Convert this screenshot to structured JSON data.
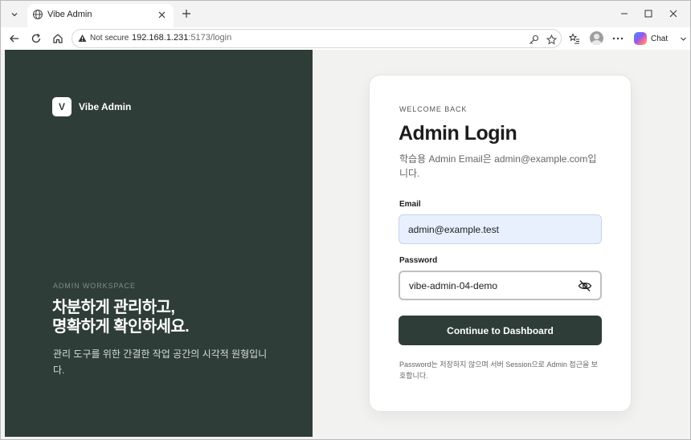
{
  "browser": {
    "tab_title": "Vibe Admin",
    "security_label": "Not secure",
    "url_host": "192.168.1.231",
    "url_path": ":5173/login",
    "chat_label": "Chat"
  },
  "left_panel": {
    "brand_mark": "V",
    "brand_name": "Vibe Admin",
    "eyebrow": "ADMIN WORKSPACE",
    "title_line1": "차분하게 관리하고,",
    "title_line2": "명확하게 확인하세요.",
    "description": "관리 도구를 위한 간결한 작업 공간의 시각적 원형입니다."
  },
  "login": {
    "eyebrow": "WELCOME BACK",
    "title": "Admin Login",
    "description": "학습용 Admin Email은 admin@example.com입니다.",
    "email_label": "Email",
    "email_value": "admin@example.test",
    "password_label": "Password",
    "password_value": "vibe-admin-04-demo",
    "submit_label": "Continue to Dashboard",
    "footnote": "Password는 저장하지 않으며 서버 Session으로 Admin 접근을 보호합니다."
  },
  "icons": {
    "tab_favicon": "globe-icon",
    "security": "warning-icon",
    "password_toggle": "eye-off-icon"
  },
  "colors": {
    "panel": "#2f3d38",
    "button": "#2f3d38",
    "email_autofill": "#e8f0fe"
  }
}
